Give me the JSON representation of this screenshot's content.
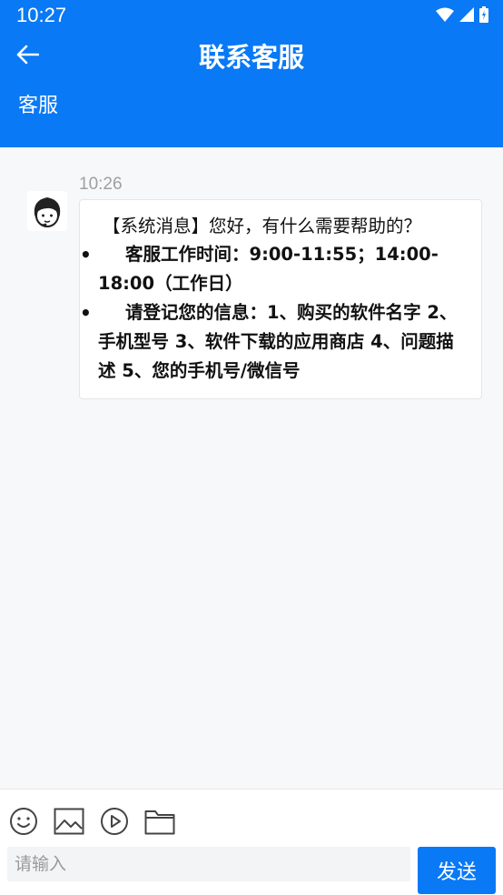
{
  "status_bar": {
    "time": "10:27"
  },
  "header": {
    "title": "联系客服",
    "subtitle": "客服"
  },
  "chat": {
    "messages": [
      {
        "time": "10:26",
        "intro": "【系统消息】您好，有什么需要帮助的？",
        "bullets": [
          "客服工作时间：9:00-11:55；14:00-18:00（工作日）",
          "请登记您的信息：1、购买的软件名字 2、手机型号 3、软件下载的应用商店 4、问题描述 5、您的手机号/微信号"
        ]
      }
    ]
  },
  "composer": {
    "placeholder": "请输入",
    "send_label": "发送",
    "tools": [
      "emoji-icon",
      "image-icon",
      "video-icon",
      "folder-icon"
    ]
  },
  "colors": {
    "brand": "#0979f5",
    "background": "#f7f8fa"
  }
}
